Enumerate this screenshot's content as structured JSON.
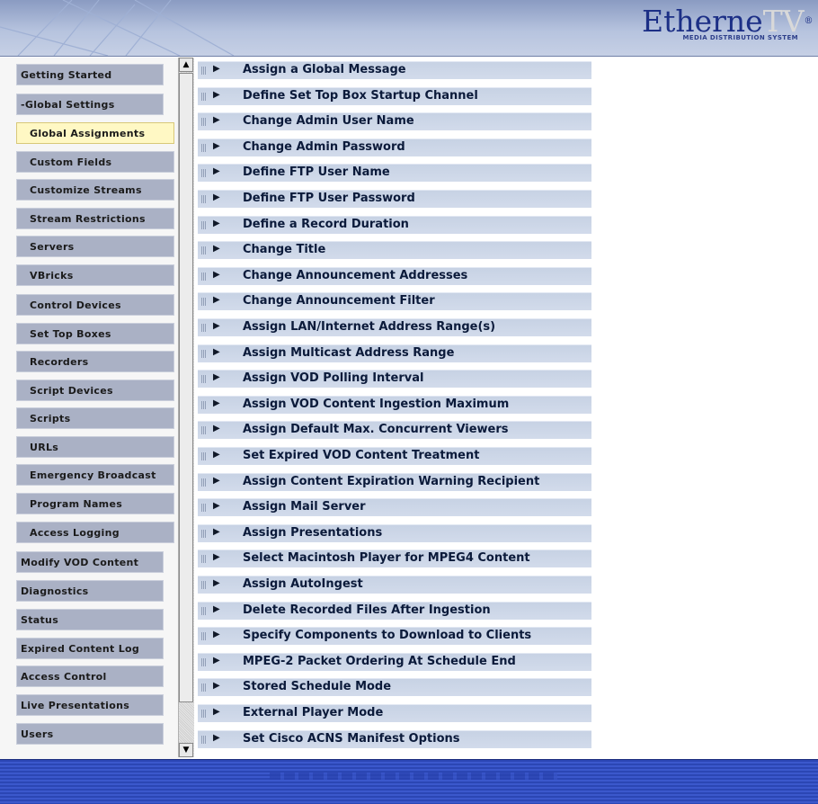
{
  "header": {
    "logo_main": "Etherne",
    "logo_accent": "TV",
    "logo_reg": "®",
    "logo_subtitle": "MEDIA DISTRIBUTION SYSTEM"
  },
  "sidebar": {
    "items": [
      {
        "label": "Getting Started",
        "level": "top"
      },
      {
        "label": "-Global Settings",
        "level": "top"
      },
      {
        "label": "Global Assignments",
        "level": "sub",
        "active": true
      },
      {
        "label": "Custom Fields",
        "level": "sub"
      },
      {
        "label": "Customize Streams",
        "level": "sub"
      },
      {
        "label": "Stream Restrictions",
        "level": "sub"
      },
      {
        "label": "Servers",
        "level": "sub"
      },
      {
        "label": "VBricks",
        "level": "sub"
      },
      {
        "label": "Control Devices",
        "level": "sub"
      },
      {
        "label": "Set Top Boxes",
        "level": "sub"
      },
      {
        "label": "Recorders",
        "level": "sub"
      },
      {
        "label": "Script Devices",
        "level": "sub"
      },
      {
        "label": "Scripts",
        "level": "sub"
      },
      {
        "label": "URLs",
        "level": "sub"
      },
      {
        "label": "Emergency Broadcast",
        "level": "sub"
      },
      {
        "label": "Program Names",
        "level": "sub"
      },
      {
        "label": "Access Logging",
        "level": "sub"
      },
      {
        "label": "Modify VOD Content",
        "level": "top"
      },
      {
        "label": "Diagnostics",
        "level": "top"
      },
      {
        "label": "Status",
        "level": "top"
      },
      {
        "label": "Expired Content Log",
        "level": "top"
      },
      {
        "label": "Access Control",
        "level": "top"
      },
      {
        "label": "Live Presentations",
        "level": "top"
      },
      {
        "label": "Users",
        "level": "top"
      }
    ]
  },
  "scrollbar": {
    "up_glyph": "▲",
    "down_glyph": "▼"
  },
  "main": {
    "arrow_glyph": "▶",
    "items": [
      "Assign a Global Message",
      "Define Set Top Box Startup Channel",
      "Change Admin User Name",
      "Change Admin Password",
      "Define FTP User Name",
      "Define FTP User Password",
      "Define a Record Duration",
      "Change Title",
      "Change Announcement Addresses",
      "Change Announcement Filter",
      "Assign LAN/Internet Address Range(s)",
      "Assign Multicast Address Range",
      "Assign VOD Polling Interval",
      "Assign VOD Content Ingestion Maximum",
      "Assign Default Max. Concurrent Viewers",
      "Set Expired VOD Content Treatment",
      "Assign Content Expiration Warning Recipient",
      "Assign Mail Server",
      "Assign Presentations",
      "Select Macintosh Player for MPEG4 Content",
      "Assign AutoIngest",
      "Delete Recorded Files After Ingestion",
      "Specify Components to Download to Clients",
      "MPEG-2 Packet Ordering At Schedule End",
      "Stored Schedule Mode",
      "External Player Mode",
      "Set Cisco ACNS Manifest Options"
    ]
  },
  "colors": {
    "header_top": "#8a9bc2",
    "logo_blue": "#1c2f86",
    "nav_bg": "#aab1c5",
    "nav_active": "#fff8c4",
    "item_bg": "#c7d2e4",
    "footer_blue": "#3b58cc"
  }
}
